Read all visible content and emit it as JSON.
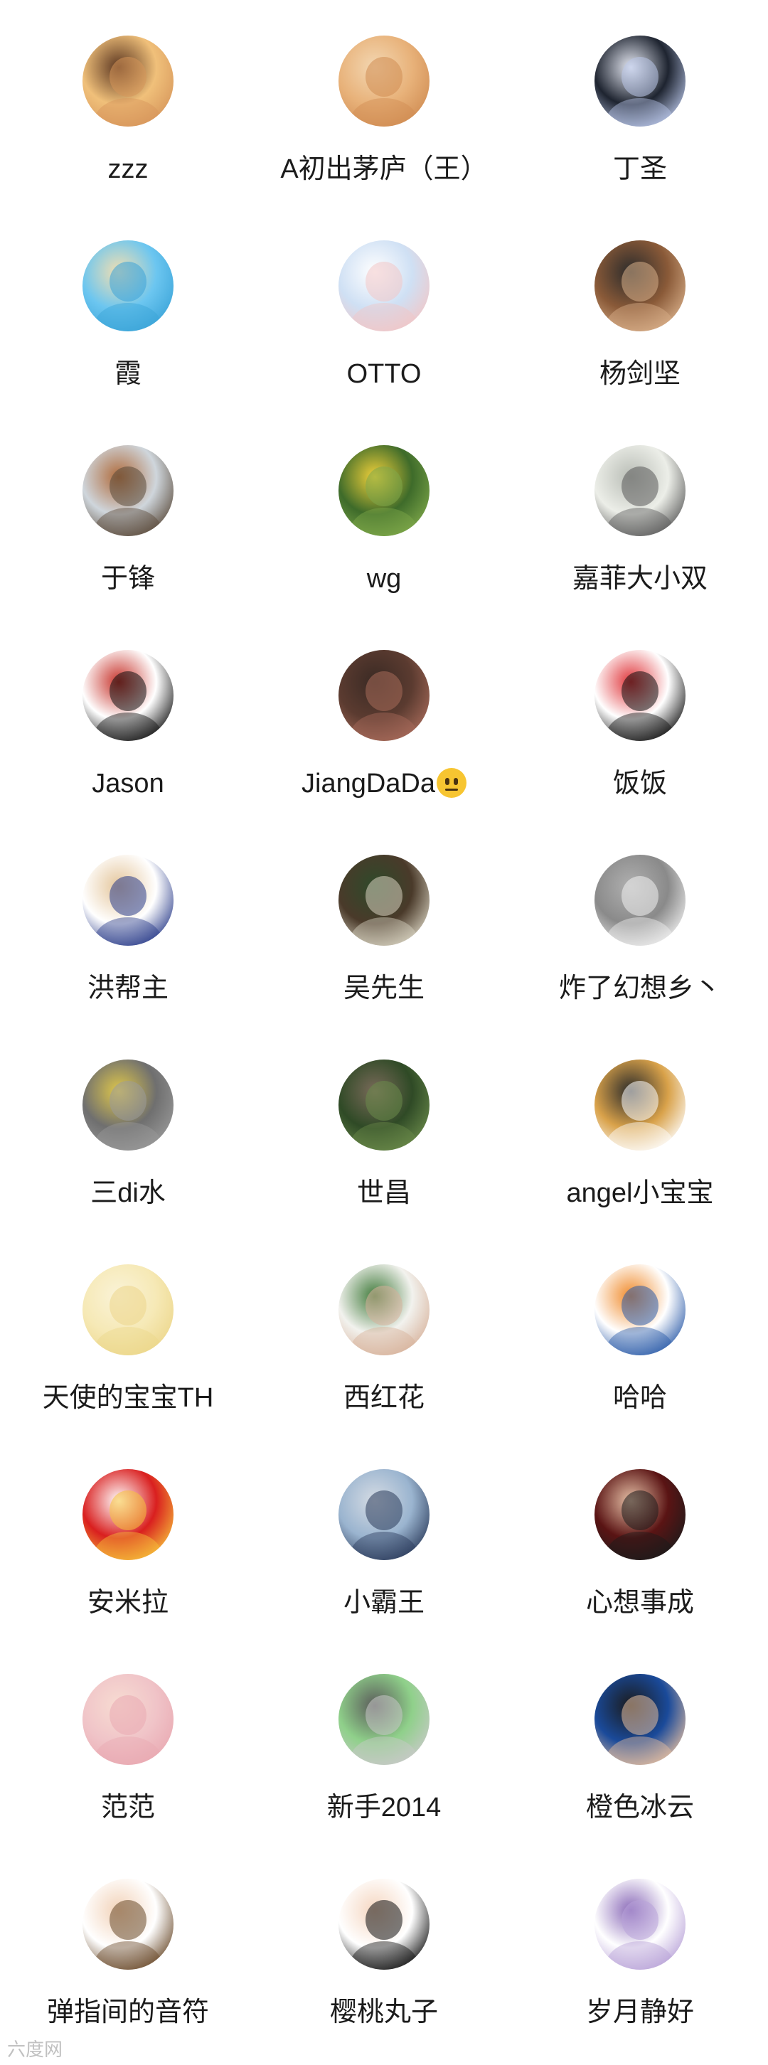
{
  "contacts": [
    {
      "name": "zzz",
      "avatar": "dog-photo",
      "colors": [
        "#f0c07a",
        "#d6955a",
        "#5a3520"
      ]
    },
    {
      "name": "A初出茅庐（王）",
      "avatar": "cat-photo",
      "colors": [
        "#e8b27a",
        "#d08c52",
        "#f3d7b2"
      ]
    },
    {
      "name": "丁圣",
      "avatar": "anime-girl",
      "colors": [
        "#1e2430",
        "#b9c6e8",
        "#e7eaf4"
      ]
    },
    {
      "name": "霞",
      "avatar": "beach-photo",
      "colors": [
        "#6cc6f0",
        "#3aa3d8",
        "#f4dfb0"
      ]
    },
    {
      "name": "OTTO",
      "avatar": "cartoon-figure",
      "colors": [
        "#cfe0f4",
        "#f2c6c6",
        "#ffffff"
      ]
    },
    {
      "name": "杨剑坚",
      "avatar": "man-photo",
      "colors": [
        "#8a5a38",
        "#d9b08a",
        "#2b2b2b"
      ]
    },
    {
      "name": "于锋",
      "avatar": "pagoda-photo",
      "colors": [
        "#cfd6dc",
        "#5a4a3a",
        "#b06a3a"
      ]
    },
    {
      "name": "wg",
      "avatar": "flowers-photo",
      "colors": [
        "#3e6b2a",
        "#7fa84a",
        "#f2d13a"
      ]
    },
    {
      "name": "嘉菲大小双",
      "avatar": "calligraphy",
      "colors": [
        "#eceee8",
        "#5a5a5a",
        "#b9bdb6"
      ]
    },
    {
      "name": "Jason",
      "avatar": "ink-calligraphy",
      "colors": [
        "#ffffff",
        "#111111",
        "#c7322a"
      ]
    },
    {
      "name": "JiangDaDa",
      "avatar": "hands-photo",
      "colors": [
        "#5b3b30",
        "#a86b5a",
        "#3a2a24"
      ]
    },
    {
      "name": "饭饭",
      "avatar": "panda-cartoon",
      "colors": [
        "#ffffff",
        "#111111",
        "#e0353a"
      ]
    },
    {
      "name": "洪帮主",
      "avatar": "detective-cartoon",
      "colors": [
        "#ffffff",
        "#2a3c8a",
        "#e4c59a"
      ]
    },
    {
      "name": "吴先生",
      "avatar": "gate-photo",
      "colors": [
        "#4a3a2a",
        "#d8d2c0",
        "#2e4a2a"
      ]
    },
    {
      "name": "炸了幻想乡丶",
      "avatar": "white-cat-photo",
      "colors": [
        "#8a8a8a",
        "#f0f0f0",
        "#b0b0b0"
      ]
    },
    {
      "name": "三di水",
      "avatar": "grey-cat-photo",
      "colors": [
        "#6f6f6f",
        "#9a9a9a",
        "#e0c84a"
      ]
    },
    {
      "name": "世昌",
      "avatar": "trees-photo",
      "colors": [
        "#2f4a26",
        "#6a8a4a",
        "#7a6a5a"
      ]
    },
    {
      "name": "angel小宝宝",
      "avatar": "child-cartoon",
      "colors": [
        "#d9a24a",
        "#ffffff",
        "#2a2a2a"
      ]
    },
    {
      "name": "天使的宝宝TH",
      "avatar": "plain-gold",
      "colors": [
        "#f6e9b6",
        "#ecd68a",
        "#faf3d8"
      ]
    },
    {
      "name": "西红花",
      "avatar": "twins-photo",
      "colors": [
        "#f2f2ee",
        "#d7b19a",
        "#3f7a3a"
      ]
    },
    {
      "name": "哈哈",
      "avatar": "product-box",
      "colors": [
        "#ffffff",
        "#2b5ba8",
        "#f08a2a"
      ]
    },
    {
      "name": "安米拉",
      "avatar": "fu-character",
      "colors": [
        "#d91f1f",
        "#f6c23a",
        "#ffffff"
      ]
    },
    {
      "name": "小霸王",
      "avatar": "men-banner-photo",
      "colors": [
        "#9ab4cf",
        "#2a3a5a",
        "#d6dce4"
      ]
    },
    {
      "name": "心想事成",
      "avatar": "man-dark-photo",
      "colors": [
        "#5a1414",
        "#1b1b1b",
        "#e8c2a8"
      ]
    },
    {
      "name": "范范",
      "avatar": "baby-photo",
      "colors": [
        "#f0c4c8",
        "#e9a9b2",
        "#f7dcd2"
      ]
    },
    {
      "name": "新手2014",
      "avatar": "leopard-photo",
      "colors": [
        "#8fd08a",
        "#c9c9c9",
        "#5a5a5a"
      ]
    },
    {
      "name": "橙色冰云",
      "avatar": "athlete-photo",
      "colors": [
        "#1a4a9a",
        "#e6bfa0",
        "#1b1b1b"
      ]
    },
    {
      "name": "弹指间的音符",
      "avatar": "boy-cartoon",
      "colors": [
        "#ffffff",
        "#6a4a2a",
        "#f2d2b8"
      ]
    },
    {
      "name": "樱桃丸子",
      "avatar": "maruko-cartoon",
      "colors": [
        "#ffffff",
        "#111111",
        "#f5d6c0"
      ]
    },
    {
      "name": "岁月静好",
      "avatar": "purple-calligraphy",
      "colors": [
        "#ffffff",
        "#b8a2d8",
        "#8a6ab8"
      ]
    }
  ],
  "watermark": "六度网"
}
